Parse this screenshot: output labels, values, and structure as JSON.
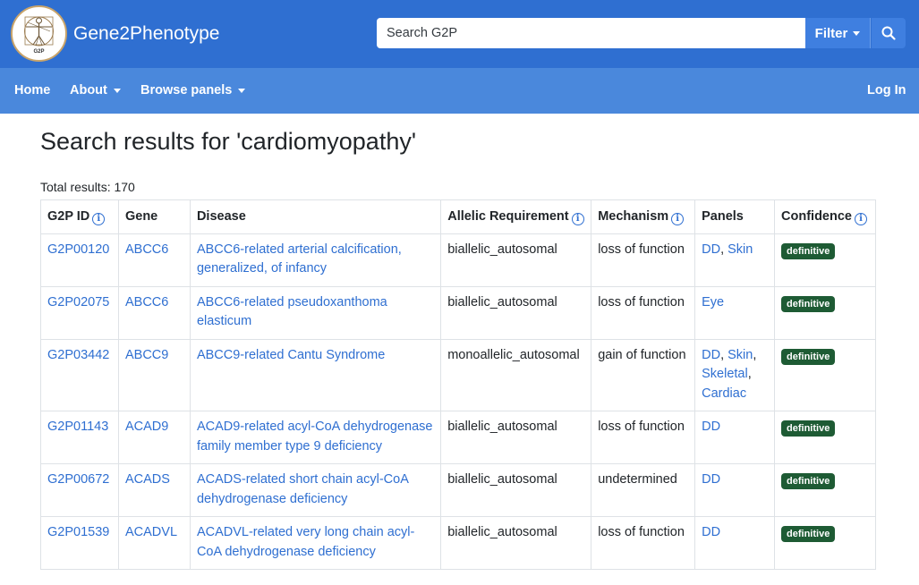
{
  "header": {
    "brand": "Gene2Phenotype",
    "logo_text": "G2P",
    "search_placeholder": "Search G2P",
    "filter_label": "Filter"
  },
  "nav": {
    "home": "Home",
    "about": "About",
    "browse": "Browse panels",
    "login": "Log In"
  },
  "main": {
    "heading": "Search results for 'cardiomyopathy'",
    "total": "Total results: 170"
  },
  "table": {
    "headers": [
      "G2P ID",
      "Gene",
      "Disease",
      "Allelic Requirement",
      "Mechanism",
      "Panels",
      "Confidence"
    ],
    "rows": [
      {
        "id": "G2P00120",
        "gene": "ABCC6",
        "disease": "ABCC6-related arterial calcification, generalized, of infancy",
        "allelic": "biallelic_autosomal",
        "mechanism": "loss of function",
        "panels": [
          "DD",
          "Skin"
        ],
        "confidence": "definitive"
      },
      {
        "id": "G2P02075",
        "gene": "ABCC6",
        "disease": "ABCC6-related pseudoxanthoma elasticum",
        "allelic": "biallelic_autosomal",
        "mechanism": "loss of function",
        "panels": [
          "Eye"
        ],
        "confidence": "definitive"
      },
      {
        "id": "G2P03442",
        "gene": "ABCC9",
        "disease": "ABCC9-related Cantu Syndrome",
        "allelic": "monoallelic_autosomal",
        "mechanism": "gain of function",
        "panels": [
          "DD",
          "Skin",
          "Skeletal",
          "Cardiac"
        ],
        "confidence": "definitive"
      },
      {
        "id": "G2P01143",
        "gene": "ACAD9",
        "disease": "ACAD9-related acyl-CoA dehydrogenase family member type 9 deficiency",
        "allelic": "biallelic_autosomal",
        "mechanism": "loss of function",
        "panels": [
          "DD"
        ],
        "confidence": "definitive"
      },
      {
        "id": "G2P00672",
        "gene": "ACADS",
        "disease": "ACADS-related short chain acyl-CoA dehydrogenase deficiency",
        "allelic": "biallelic_autosomal",
        "mechanism": "undetermined",
        "panels": [
          "DD"
        ],
        "confidence": "definitive"
      },
      {
        "id": "G2P01539",
        "gene": "ACADVL",
        "disease": "ACADVL-related very long chain acyl-CoA dehydrogenase deficiency",
        "allelic": "biallelic_autosomal",
        "mechanism": "loss of function",
        "panels": [
          "DD"
        ],
        "confidence": "definitive"
      }
    ]
  },
  "colors": {
    "topbar": "#2f6fd1",
    "navbar": "#4a88dc",
    "link": "#2f6fd1",
    "badge": "#1e5b34"
  },
  "icons": {
    "logo": "vitruvian-man-logo",
    "search": "search-icon",
    "info": "info-icon",
    "caret": "chevron-down-icon"
  }
}
